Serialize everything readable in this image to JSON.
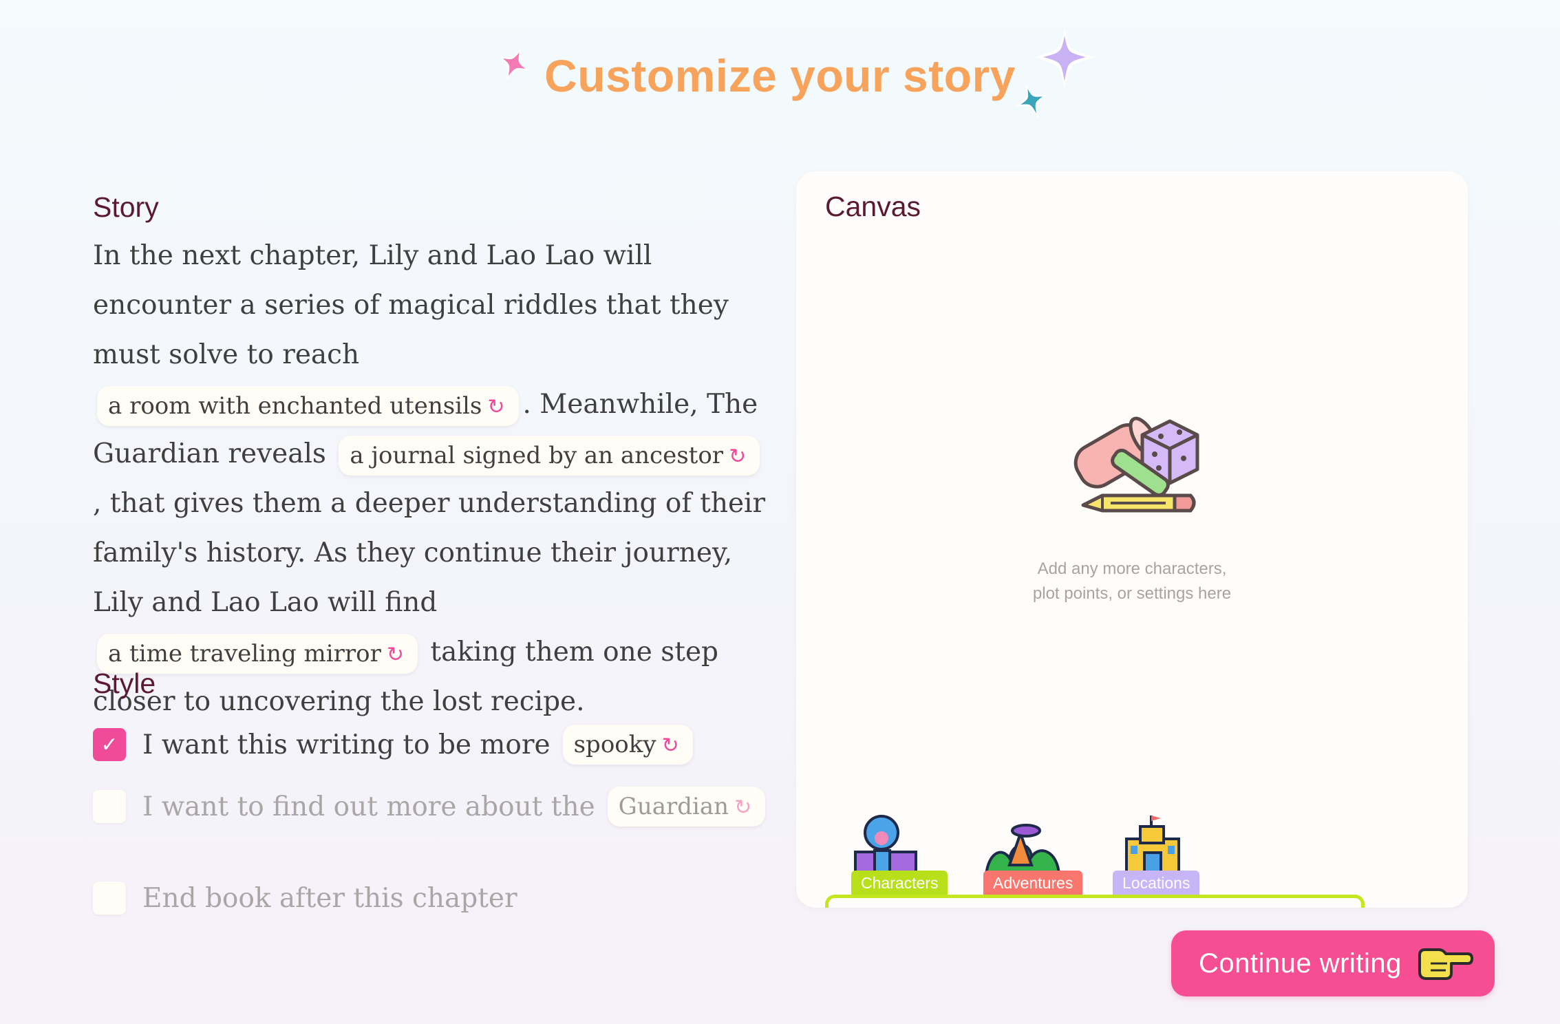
{
  "header": {
    "title": "Customize your story"
  },
  "story": {
    "label": "Story",
    "seg1": "In the next chapter, Lily and Lao Lao will encounter a series of magical riddles that they must solve to reach",
    "chip1": "a room with enchanted utensils",
    "seg2": ". Meanwhile, The Guardian reveals",
    "chip2": "a journal signed by an ancestor",
    "seg3": ", that gives them a deeper understanding of their family's history. As they continue their journey, Lily and Lao Lao will find",
    "chip3": "a time traveling mirror",
    "seg4": "taking them one step closer to uncovering the lost recipe."
  },
  "style": {
    "label": "Style",
    "options": [
      {
        "text": "I want this writing to be more",
        "chip": "spooky",
        "checked": true
      },
      {
        "text": "I want to find out more about the",
        "chip": "Guardian",
        "checked": false
      },
      {
        "text": "End book after this chapter",
        "checked": false
      }
    ]
  },
  "canvas": {
    "label": "Canvas",
    "hint_line1": "Add any more characters,",
    "hint_line2": "plot points, or settings here",
    "tabs": [
      {
        "label": "Characters",
        "color": "#b7e01a"
      },
      {
        "label": "Adventures",
        "color": "#f8766d"
      },
      {
        "label": "Locations",
        "color": "#c8b5f7"
      }
    ]
  },
  "actions": {
    "continue_label": "Continue writing"
  },
  "colors": {
    "title": "#f7a35c",
    "accent": "#f54e93",
    "section_label": "#5b1a32"
  }
}
